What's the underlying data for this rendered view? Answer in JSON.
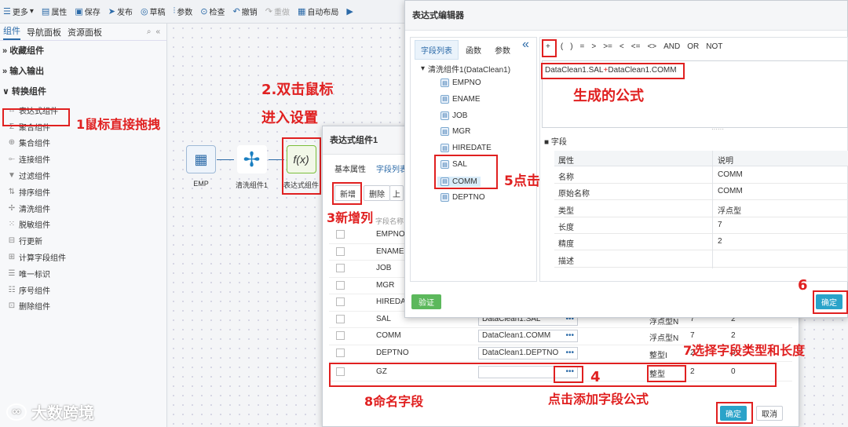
{
  "toolbar": {
    "items": [
      "更多",
      "属性",
      "保存",
      "发布",
      "草稿",
      "参数",
      "检查",
      "撤销",
      "重做",
      "自动布局"
    ]
  },
  "left_panel": {
    "tabs": [
      "组件",
      "导航面板",
      "资源面板"
    ],
    "groups": [
      "收藏组件",
      "输入输出",
      "转换组件"
    ],
    "components": [
      "表达式组件",
      "聚合组件",
      "集合组件",
      "连接组件",
      "过滤组件",
      "排序组件",
      "清洗组件",
      "脱敏组件",
      "行更新",
      "计算字段组件",
      "唯一标识",
      "序号组件",
      "删除组件"
    ]
  },
  "canvas": {
    "nodes": [
      {
        "label": "EMP",
        "icon": "table-icon"
      },
      {
        "label": "清洗组件1",
        "icon": "fan-icon"
      },
      {
        "label": "表达式组件",
        "icon": "fx-icon"
      }
    ]
  },
  "dialog1": {
    "title": "表达式组件1",
    "tabs": [
      "基本属性",
      "字段列表"
    ],
    "buttons": [
      "新增",
      "删除",
      "上"
    ],
    "header_partial": "字段名称",
    "rows": [
      {
        "name": "EMPNO",
        "formula": "",
        "type": "",
        "len": "",
        "prec": ""
      },
      {
        "name": "ENAME",
        "formula": "",
        "type": "",
        "len": "",
        "prec": ""
      },
      {
        "name": "JOB",
        "formula": "",
        "type": "",
        "len": "",
        "prec": ""
      },
      {
        "name": "MGR",
        "formula": "",
        "type": "",
        "len": "",
        "prec": ""
      },
      {
        "name": "HIREDA",
        "formula": "",
        "type": "",
        "len": "",
        "prec": ""
      },
      {
        "name": "SAL",
        "formula": "DataClean1.SAL",
        "type": "浮点型N",
        "len": "7",
        "prec": "2"
      },
      {
        "name": "COMM",
        "formula": "DataClean1.COMM",
        "type": "浮点型N",
        "len": "7",
        "prec": "2"
      },
      {
        "name": "DEPTNO",
        "formula": "DataClean1.DEPTNO",
        "type": "整型I",
        "len": "2",
        "prec": "0"
      },
      {
        "name": "GZ",
        "formula": "",
        "type": "整型",
        "len": "2",
        "prec": "0"
      }
    ],
    "ok": "确定",
    "cancel": "取消"
  },
  "dialog2": {
    "title": "表达式编辑器",
    "tabs": [
      "字段列表",
      "函数",
      "参数"
    ],
    "collapse": "«",
    "tree_root": "清洗组件1(DataClean1)",
    "tree_fields": [
      "EMPNO",
      "ENAME",
      "JOB",
      "MGR",
      "HIREDATE",
      "SAL",
      "COMM",
      "DEPTNO"
    ],
    "operators": [
      "+",
      "(",
      ")",
      "=",
      ">",
      ">=",
      "<",
      "<=",
      "<>",
      "AND",
      "OR",
      "NOT"
    ],
    "formula": {
      "a": "DataClean1.SAL",
      "op": "+",
      "b": "DataClean1.COMM"
    },
    "section": "字段",
    "prop_headers": [
      "属性",
      "说明"
    ],
    "props": [
      [
        "名称",
        "COMM"
      ],
      [
        "原始名称",
        "COMM"
      ],
      [
        "类型",
        "浮点型"
      ],
      [
        "长度",
        "7"
      ],
      [
        "精度",
        "2"
      ],
      [
        "描述",
        ""
      ]
    ],
    "verify": "验证",
    "ok": "确定"
  },
  "annotations": {
    "a1": "1鼠标直接拖拽",
    "a2a": "2.双击鼠标",
    "a2b": "进入设置",
    "a3": "3新增列",
    "a4": "4",
    "a4b": "点击添加字段公式",
    "a5": "5点击添加到公式框",
    "a6": "6",
    "a7": "7选择字段类型和长度",
    "a8": "8命名字段",
    "formula_label": "生成的公式"
  },
  "watermark": "大数跨境",
  "colors": {
    "accent": "#2b6aa8",
    "annotation": "#e02020",
    "ok": "#2aa3c9",
    "verify": "#5cb85c"
  }
}
